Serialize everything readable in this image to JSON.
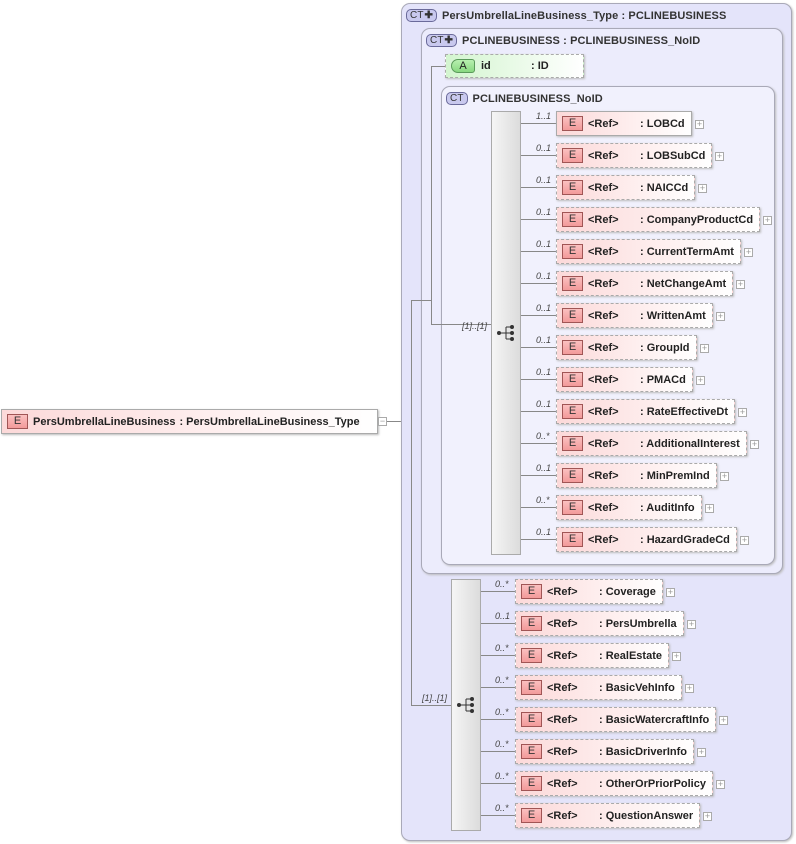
{
  "root": {
    "badge": "E",
    "name": "PersUmbrellaLineBusiness",
    "type": ": PersUmbrellaLineBusiness_Type",
    "collapse": "−"
  },
  "outer": {
    "badge": "CT",
    "title": "PersUmbrellaLineBusiness_Type : PCLINEBUSINESS"
  },
  "inner": {
    "badge": "CT",
    "title": "PCLINEBUSINESS : PCLINEBUSINESS_NoID"
  },
  "attribute": {
    "badge": "A",
    "name": "id",
    "type": ": ID"
  },
  "inner2": {
    "badge": "CT",
    "title": "PCLINEBUSINESS_NoID"
  },
  "sequence1": {
    "multiplicity": "[1]..[1]",
    "items": [
      {
        "mult": "1..1",
        "ref": "<Ref>",
        "name": ": LOBCd",
        "required": true
      },
      {
        "mult": "0..1",
        "ref": "<Ref>",
        "name": ": LOBSubCd"
      },
      {
        "mult": "0..1",
        "ref": "<Ref>",
        "name": ": NAICCd"
      },
      {
        "mult": "0..1",
        "ref": "<Ref>",
        "name": ": CompanyProductCd"
      },
      {
        "mult": "0..1",
        "ref": "<Ref>",
        "name": ": CurrentTermAmt"
      },
      {
        "mult": "0..1",
        "ref": "<Ref>",
        "name": ": NetChangeAmt"
      },
      {
        "mult": "0..1",
        "ref": "<Ref>",
        "name": ": WrittenAmt"
      },
      {
        "mult": "0..1",
        "ref": "<Ref>",
        "name": ": GroupId"
      },
      {
        "mult": "0..1",
        "ref": "<Ref>",
        "name": ": PMACd"
      },
      {
        "mult": "0..1",
        "ref": "<Ref>",
        "name": ": RateEffectiveDt"
      },
      {
        "mult": "0..*",
        "ref": "<Ref>",
        "name": ": AdditionalInterest"
      },
      {
        "mult": "0..1",
        "ref": "<Ref>",
        "name": ": MinPremInd"
      },
      {
        "mult": "0..*",
        "ref": "<Ref>",
        "name": ": AuditInfo"
      },
      {
        "mult": "0..1",
        "ref": "<Ref>",
        "name": ": HazardGradeCd"
      }
    ]
  },
  "sequence2": {
    "multiplicity": "[1]..[1]",
    "items": [
      {
        "mult": "0..*",
        "ref": "<Ref>",
        "name": ": Coverage"
      },
      {
        "mult": "0..1",
        "ref": "<Ref>",
        "name": ": PersUmbrella"
      },
      {
        "mult": "0..*",
        "ref": "<Ref>",
        "name": ": RealEstate"
      },
      {
        "mult": "0..*",
        "ref": "<Ref>",
        "name": ": BasicVehInfo"
      },
      {
        "mult": "0..*",
        "ref": "<Ref>",
        "name": ": BasicWatercraftInfo"
      },
      {
        "mult": "0..*",
        "ref": "<Ref>",
        "name": ": BasicDriverInfo"
      },
      {
        "mult": "0..*",
        "ref": "<Ref>",
        "name": ": OtherOrPriorPolicy"
      },
      {
        "mult": "0..*",
        "ref": "<Ref>",
        "name": ": QuestionAnswer"
      }
    ]
  },
  "element_badge": "E"
}
